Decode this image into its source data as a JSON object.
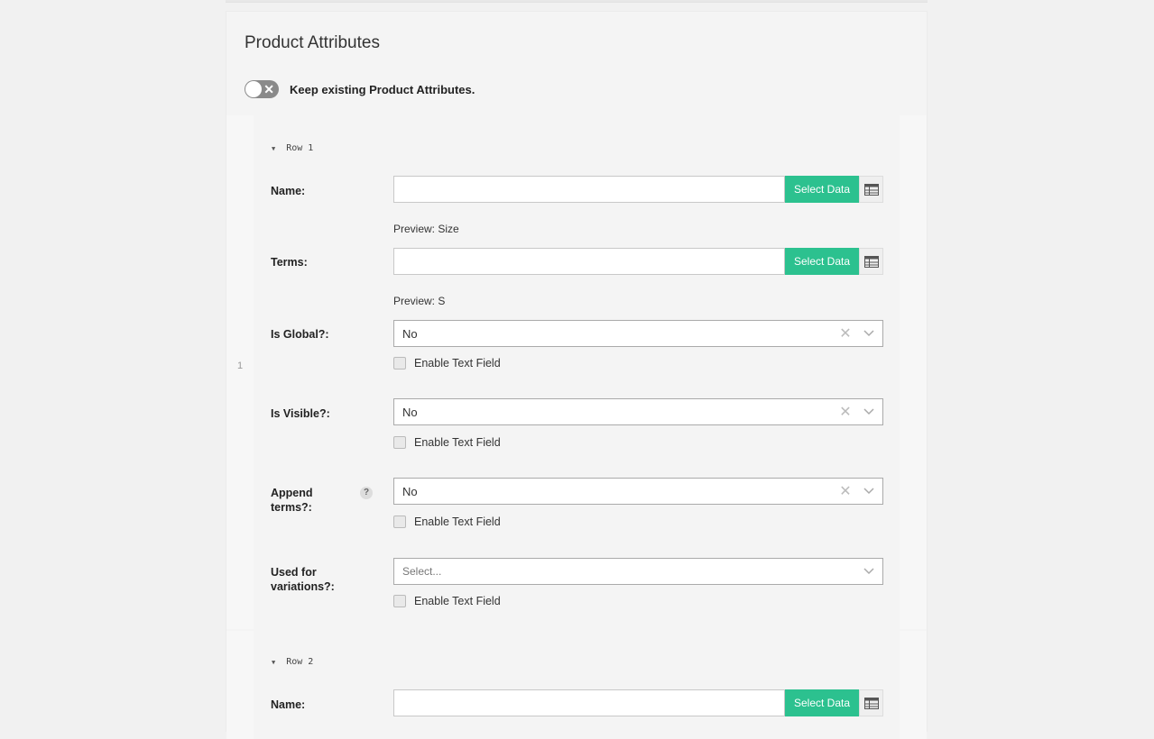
{
  "section": {
    "title": "Product Attributes",
    "keep_toggle_label": "Keep existing Product Attributes."
  },
  "rows": [
    {
      "index": "1",
      "header": "Row 1",
      "name": {
        "label": "Name:",
        "value": "",
        "select_btn": "Select Data",
        "preview": "Preview: Size"
      },
      "terms": {
        "label": "Terms:",
        "value": "",
        "select_btn": "Select Data",
        "preview": "Preview: S"
      },
      "is_global": {
        "label": "Is Global?:",
        "value": "No",
        "checkbox_label": "Enable Text Field"
      },
      "is_visible": {
        "label": "Is Visible?:",
        "value": "No",
        "checkbox_label": "Enable Text Field"
      },
      "append_terms": {
        "label_line1": "Append",
        "label_line2": "terms?:",
        "help": "?",
        "value": "No",
        "checkbox_label": "Enable Text Field"
      },
      "used_for_variations": {
        "label_line1": "Used for",
        "label_line2": "variations?:",
        "placeholder": "Select...",
        "checkbox_label": "Enable Text Field"
      }
    },
    {
      "header": "Row 2",
      "name": {
        "label": "Name:",
        "value": "",
        "select_btn": "Select Data"
      }
    }
  ],
  "icons": {
    "toggle_off": "x-icon",
    "table": "table-icon",
    "clear": "close-icon",
    "dropdown": "chevron-down-icon",
    "caret": "caret-down-icon"
  },
  "colors": {
    "select_data_button": "#2cc18f",
    "toggle_off": "#8a8a8a"
  }
}
